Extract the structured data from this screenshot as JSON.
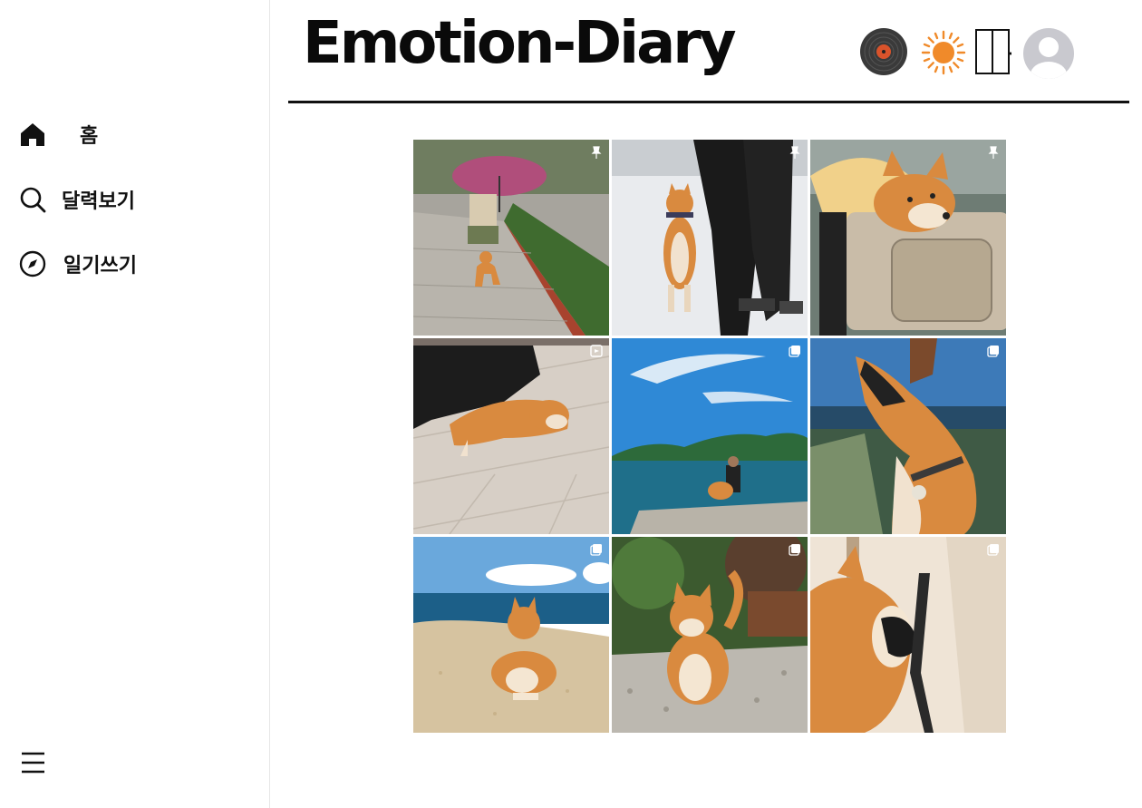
{
  "app": {
    "title": "Emotion-Diary"
  },
  "sidebar": {
    "items": [
      {
        "label": "홈",
        "icon": "home-icon"
      },
      {
        "label": "달력보기",
        "icon": "search-icon"
      },
      {
        "label": "일기쓰기",
        "icon": "compass-icon"
      }
    ],
    "menu_icon": "hamburger-menu-icon"
  },
  "header": {
    "icons": [
      "vinyl-record-icon",
      "sun-icon",
      "door-icon",
      "avatar-icon"
    ]
  },
  "grid": {
    "items": [
      {
        "subject": "shiba walking under umbrella on wet path",
        "badge": "pin-icon"
      },
      {
        "subject": "shiba standing on hind legs in snow",
        "badge": "pin-icon"
      },
      {
        "subject": "shiba in carrier bag",
        "badge": "pin-icon"
      },
      {
        "subject": "shiba sleeping on wooden floor",
        "badge": "reel-icon"
      },
      {
        "subject": "person and shiba at lakeside",
        "badge": "carousel-icon"
      },
      {
        "subject": "shiba howling outdoors",
        "badge": "carousel-icon"
      },
      {
        "subject": "shiba lying on beach sand",
        "badge": "carousel-icon"
      },
      {
        "subject": "smiling shiba on gravel",
        "badge": "carousel-icon"
      },
      {
        "subject": "shiba biting leash",
        "badge": "carousel-icon"
      }
    ]
  },
  "colors": {
    "accent": "#111111",
    "sun": "#f08a2a",
    "shiba": "#d98a3f"
  }
}
